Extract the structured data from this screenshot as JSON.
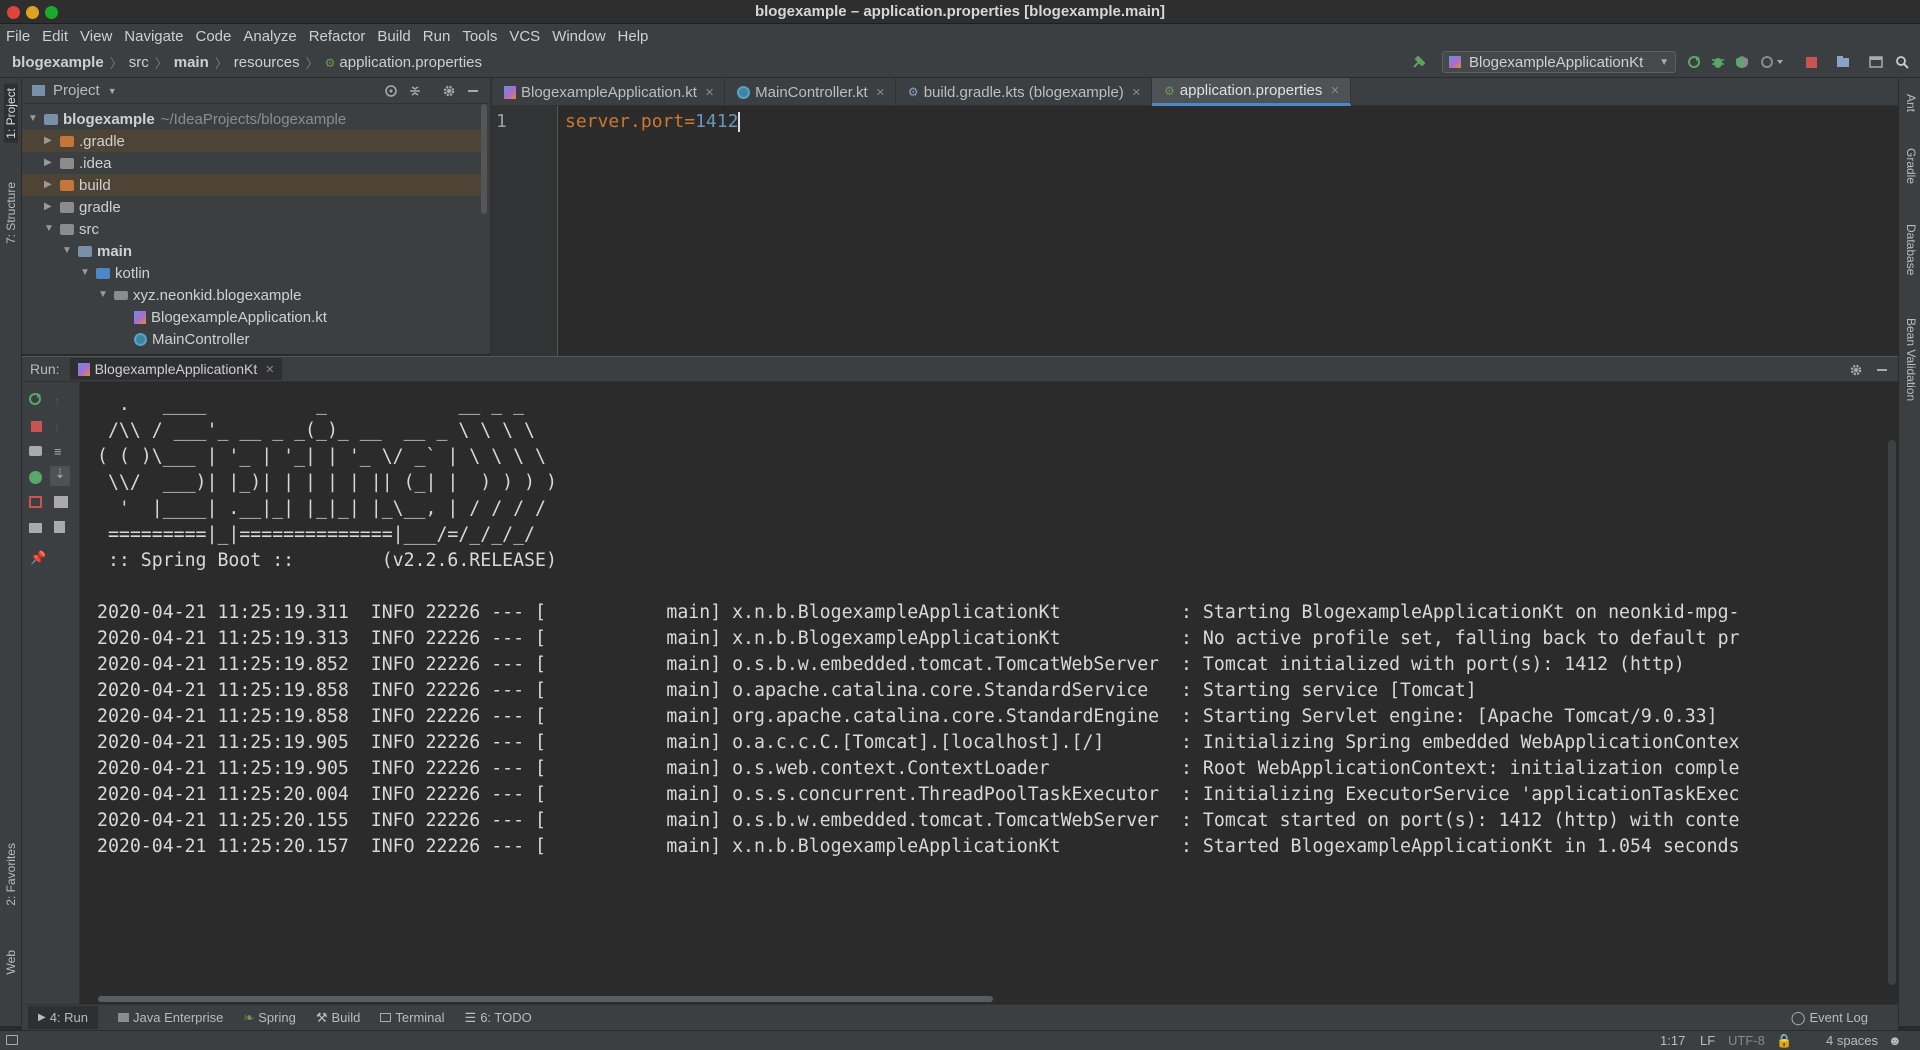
{
  "window": {
    "title": "blogexample – application.properties [blogexample.main]"
  },
  "menu": [
    "File",
    "Edit",
    "View",
    "Navigate",
    "Code",
    "Analyze",
    "Refactor",
    "Build",
    "Run",
    "Tools",
    "VCS",
    "Window",
    "Help"
  ],
  "breadcrumb": [
    "blogexample",
    "src",
    "main",
    "resources",
    "application.properties"
  ],
  "run_config": "BlogexampleApplicationKt",
  "project": {
    "header": "Project",
    "root_name": "blogexample",
    "root_path": "~/IdeaProjects/blogexample",
    "items": [
      ".gradle",
      ".idea",
      "build",
      "gradle",
      "src",
      "main",
      "kotlin",
      "xyz.neonkid.blogexample",
      "BlogexampleApplication.kt",
      "MainController"
    ]
  },
  "editor": {
    "tabs": [
      "BlogexampleApplication.kt",
      "MainController.kt",
      "build.gradle.kts (blogexample)",
      "application.properties"
    ],
    "line_number": "1",
    "code_key": "server.port",
    "code_eq": "=",
    "code_val": "1412"
  },
  "run": {
    "label": "Run:",
    "tab": "BlogexampleApplicationKt",
    "banner": [
      "  .   ____          _            __ _ _",
      " /\\\\ / ___'_ __ _ _(_)_ __  __ _ \\ \\ \\ \\",
      "( ( )\\___ | '_ | '_| | '_ \\/ _` | \\ \\ \\ \\",
      " \\\\/  ___)| |_)| | | | | || (_| |  ) ) ) )",
      "  '  |____| .__|_| |_|_| |_\\__, | / / / /",
      " =========|_|==============|___/=/_/_/_/",
      " :: Spring Boot ::        (v2.2.6.RELEASE)"
    ],
    "logs": [
      "2020-04-21 11:25:19.311  INFO 22226 --- [           main] x.n.b.BlogexampleApplicationKt           : Starting BlogexampleApplicationKt on neonkid-mpg-",
      "2020-04-21 11:25:19.313  INFO 22226 --- [           main] x.n.b.BlogexampleApplicationKt           : No active profile set, falling back to default pr",
      "2020-04-21 11:25:19.852  INFO 22226 --- [           main] o.s.b.w.embedded.tomcat.TomcatWebServer  : Tomcat initialized with port(s): 1412 (http)",
      "2020-04-21 11:25:19.858  INFO 22226 --- [           main] o.apache.catalina.core.StandardService   : Starting service [Tomcat]",
      "2020-04-21 11:25:19.858  INFO 22226 --- [           main] org.apache.catalina.core.StandardEngine  : Starting Servlet engine: [Apache Tomcat/9.0.33]",
      "2020-04-21 11:25:19.905  INFO 22226 --- [           main] o.a.c.c.C.[Tomcat].[localhost].[/]       : Initializing Spring embedded WebApplicationContex",
      "2020-04-21 11:25:19.905  INFO 22226 --- [           main] o.s.web.context.ContextLoader            : Root WebApplicationContext: initialization comple",
      "2020-04-21 11:25:20.004  INFO 22226 --- [           main] o.s.s.concurrent.ThreadPoolTaskExecutor  : Initializing ExecutorService 'applicationTaskExec",
      "2020-04-21 11:25:20.155  INFO 22226 --- [           main] o.s.b.w.embedded.tomcat.TomcatWebServer  : Tomcat started on port(s): 1412 (http) with conte",
      "2020-04-21 11:25:20.157  INFO 22226 --- [           main] x.n.b.BlogexampleApplicationKt           : Started BlogexampleApplicationKt in 1.054 seconds"
    ]
  },
  "left_strip": [
    "1: Project",
    "7: Structure",
    "2: Favorites",
    "Web"
  ],
  "right_strip": [
    "Ant",
    "Gradle",
    "Database",
    "Bean Validation"
  ],
  "bottom_tabs": [
    "4: Run",
    "Java Enterprise",
    "Spring",
    "Build",
    "Terminal",
    "6: TODO"
  ],
  "event_log": "Event Log",
  "status": {
    "position": "1:17",
    "line_sep": "LF",
    "encoding": "UTF-8",
    "indent": "4 spaces"
  },
  "colors": {
    "key": "#cc7832",
    "value": "#6897bb",
    "accent": "#4a88c7"
  }
}
